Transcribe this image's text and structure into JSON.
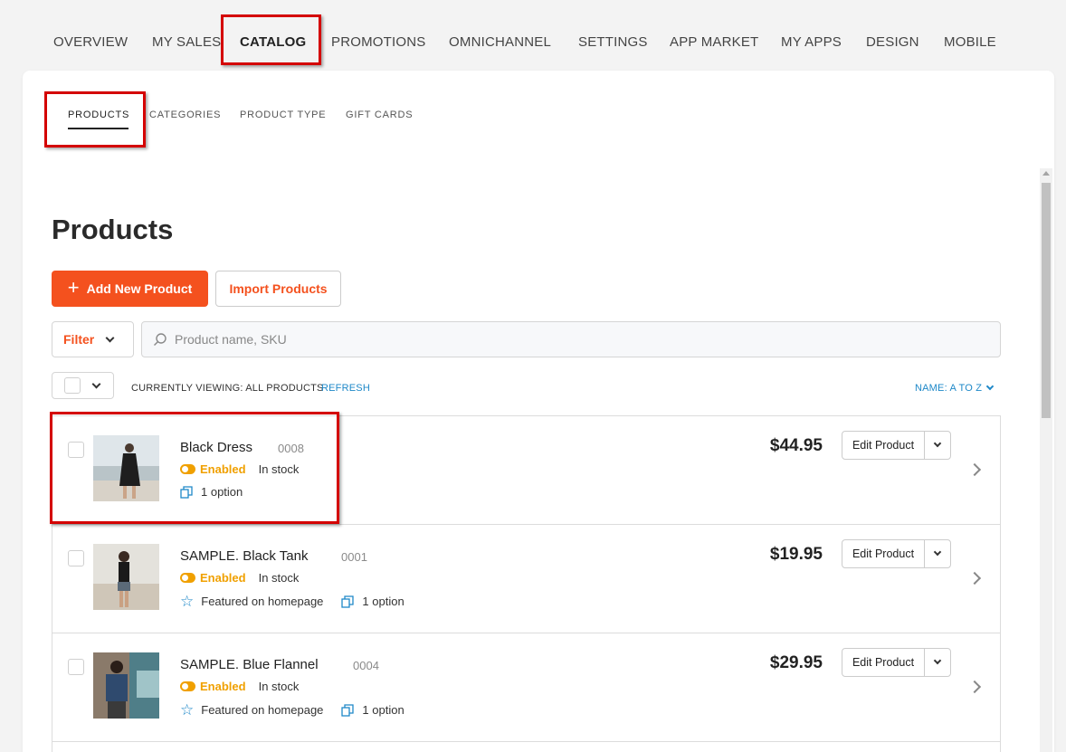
{
  "topnav": {
    "items": [
      "OVERVIEW",
      "MY SALES",
      "CATALOG",
      "PROMOTIONS",
      "OMNICHANNEL",
      "SETTINGS",
      "APP MARKET",
      "MY APPS",
      "DESIGN",
      "MOBILE"
    ],
    "active": "CATALOG"
  },
  "subnav": {
    "items": [
      "PRODUCTS",
      "CATEGORIES",
      "PRODUCT TYPE",
      "GIFT CARDS"
    ],
    "active": "PRODUCTS"
  },
  "page": {
    "title": "Products",
    "add_label": "Add New Product",
    "import_label": "Import Products",
    "filter_label": "Filter",
    "search_placeholder": "Product name, SKU",
    "viewing_label": "CURRENTLY VIEWING: ALL PRODUCTS",
    "refresh_label": "REFRESH",
    "sort_label": "NAME: A TO Z"
  },
  "colors": {
    "accent": "#f4511e",
    "link": "#1e88c8",
    "enabled": "#f0a000",
    "highlight": "#d40000"
  },
  "products": [
    {
      "name": "Black Dress",
      "sku": "0008",
      "status": "Enabled",
      "stock": "In stock",
      "featured": "",
      "options": "1 option",
      "price": "$44.95",
      "edit_label": "Edit Product"
    },
    {
      "name": "SAMPLE. Black Tank",
      "sku": "0001",
      "status": "Enabled",
      "stock": "In stock",
      "featured": "Featured on homepage",
      "options": "1 option",
      "price": "$19.95",
      "edit_label": "Edit Product"
    },
    {
      "name": "SAMPLE. Blue Flannel",
      "sku": "0004",
      "status": "Enabled",
      "stock": "In stock",
      "featured": "Featured on homepage",
      "options": "1 option",
      "price": "$29.95",
      "edit_label": "Edit Product"
    }
  ]
}
